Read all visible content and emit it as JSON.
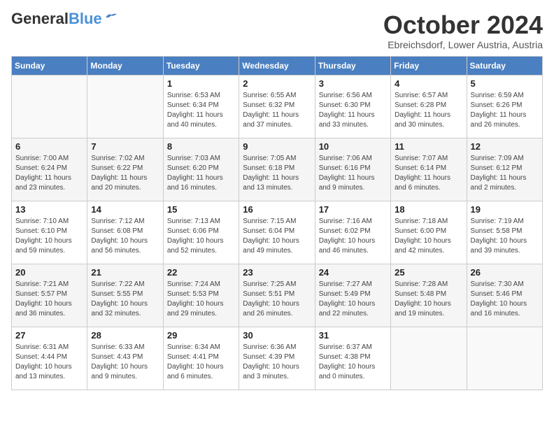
{
  "header": {
    "logo_line1": "General",
    "logo_line2": "Blue",
    "month": "October 2024",
    "location": "Ebreichsdorf, Lower Austria, Austria"
  },
  "weekdays": [
    "Sunday",
    "Monday",
    "Tuesday",
    "Wednesday",
    "Thursday",
    "Friday",
    "Saturday"
  ],
  "weeks": [
    [
      {
        "day": "",
        "info": ""
      },
      {
        "day": "",
        "info": ""
      },
      {
        "day": "1",
        "info": "Sunrise: 6:53 AM\nSunset: 6:34 PM\nDaylight: 11 hours and 40 minutes."
      },
      {
        "day": "2",
        "info": "Sunrise: 6:55 AM\nSunset: 6:32 PM\nDaylight: 11 hours and 37 minutes."
      },
      {
        "day": "3",
        "info": "Sunrise: 6:56 AM\nSunset: 6:30 PM\nDaylight: 11 hours and 33 minutes."
      },
      {
        "day": "4",
        "info": "Sunrise: 6:57 AM\nSunset: 6:28 PM\nDaylight: 11 hours and 30 minutes."
      },
      {
        "day": "5",
        "info": "Sunrise: 6:59 AM\nSunset: 6:26 PM\nDaylight: 11 hours and 26 minutes."
      }
    ],
    [
      {
        "day": "6",
        "info": "Sunrise: 7:00 AM\nSunset: 6:24 PM\nDaylight: 11 hours and 23 minutes."
      },
      {
        "day": "7",
        "info": "Sunrise: 7:02 AM\nSunset: 6:22 PM\nDaylight: 11 hours and 20 minutes."
      },
      {
        "day": "8",
        "info": "Sunrise: 7:03 AM\nSunset: 6:20 PM\nDaylight: 11 hours and 16 minutes."
      },
      {
        "day": "9",
        "info": "Sunrise: 7:05 AM\nSunset: 6:18 PM\nDaylight: 11 hours and 13 minutes."
      },
      {
        "day": "10",
        "info": "Sunrise: 7:06 AM\nSunset: 6:16 PM\nDaylight: 11 hours and 9 minutes."
      },
      {
        "day": "11",
        "info": "Sunrise: 7:07 AM\nSunset: 6:14 PM\nDaylight: 11 hours and 6 minutes."
      },
      {
        "day": "12",
        "info": "Sunrise: 7:09 AM\nSunset: 6:12 PM\nDaylight: 11 hours and 2 minutes."
      }
    ],
    [
      {
        "day": "13",
        "info": "Sunrise: 7:10 AM\nSunset: 6:10 PM\nDaylight: 10 hours and 59 minutes."
      },
      {
        "day": "14",
        "info": "Sunrise: 7:12 AM\nSunset: 6:08 PM\nDaylight: 10 hours and 56 minutes."
      },
      {
        "day": "15",
        "info": "Sunrise: 7:13 AM\nSunset: 6:06 PM\nDaylight: 10 hours and 52 minutes."
      },
      {
        "day": "16",
        "info": "Sunrise: 7:15 AM\nSunset: 6:04 PM\nDaylight: 10 hours and 49 minutes."
      },
      {
        "day": "17",
        "info": "Sunrise: 7:16 AM\nSunset: 6:02 PM\nDaylight: 10 hours and 46 minutes."
      },
      {
        "day": "18",
        "info": "Sunrise: 7:18 AM\nSunset: 6:00 PM\nDaylight: 10 hours and 42 minutes."
      },
      {
        "day": "19",
        "info": "Sunrise: 7:19 AM\nSunset: 5:58 PM\nDaylight: 10 hours and 39 minutes."
      }
    ],
    [
      {
        "day": "20",
        "info": "Sunrise: 7:21 AM\nSunset: 5:57 PM\nDaylight: 10 hours and 36 minutes."
      },
      {
        "day": "21",
        "info": "Sunrise: 7:22 AM\nSunset: 5:55 PM\nDaylight: 10 hours and 32 minutes."
      },
      {
        "day": "22",
        "info": "Sunrise: 7:24 AM\nSunset: 5:53 PM\nDaylight: 10 hours and 29 minutes."
      },
      {
        "day": "23",
        "info": "Sunrise: 7:25 AM\nSunset: 5:51 PM\nDaylight: 10 hours and 26 minutes."
      },
      {
        "day": "24",
        "info": "Sunrise: 7:27 AM\nSunset: 5:49 PM\nDaylight: 10 hours and 22 minutes."
      },
      {
        "day": "25",
        "info": "Sunrise: 7:28 AM\nSunset: 5:48 PM\nDaylight: 10 hours and 19 minutes."
      },
      {
        "day": "26",
        "info": "Sunrise: 7:30 AM\nSunset: 5:46 PM\nDaylight: 10 hours and 16 minutes."
      }
    ],
    [
      {
        "day": "27",
        "info": "Sunrise: 6:31 AM\nSunset: 4:44 PM\nDaylight: 10 hours and 13 minutes."
      },
      {
        "day": "28",
        "info": "Sunrise: 6:33 AM\nSunset: 4:43 PM\nDaylight: 10 hours and 9 minutes."
      },
      {
        "day": "29",
        "info": "Sunrise: 6:34 AM\nSunset: 4:41 PM\nDaylight: 10 hours and 6 minutes."
      },
      {
        "day": "30",
        "info": "Sunrise: 6:36 AM\nSunset: 4:39 PM\nDaylight: 10 hours and 3 minutes."
      },
      {
        "day": "31",
        "info": "Sunrise: 6:37 AM\nSunset: 4:38 PM\nDaylight: 10 hours and 0 minutes."
      },
      {
        "day": "",
        "info": ""
      },
      {
        "day": "",
        "info": ""
      }
    ]
  ]
}
